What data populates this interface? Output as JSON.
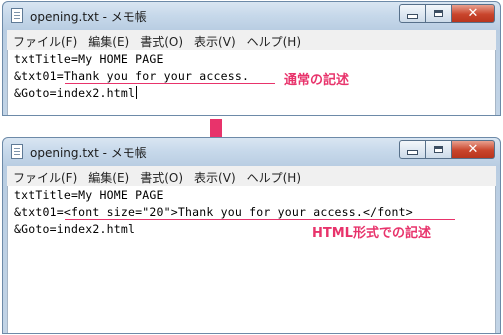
{
  "window_top": {
    "title": "opening.txt - メモ帳",
    "menu": [
      "ファイル(F)",
      "編集(E)",
      "書式(O)",
      "表示(V)",
      "ヘルプ(H)"
    ],
    "lines": [
      "txtTitle=My HOME PAGE",
      "&txt01=Thank you for your access.",
      "&Goto=index2.html"
    ],
    "annotation": "通常の記述"
  },
  "window_bottom": {
    "title": "opening.txt - メモ帳",
    "menu": [
      "ファイル(F)",
      "編集(E)",
      "書式(O)",
      "表示(V)",
      "ヘルプ(H)"
    ],
    "lines": [
      "txtTitle=My HOME PAGE",
      "&txt01=<font size=\"20\">Thank you for your access.</font>",
      "&Goto=index2.html"
    ],
    "annotation": "HTML形式での記述"
  },
  "colors": {
    "annotation": "#e8336b",
    "arrow": "#e8336b"
  },
  "icons": {
    "document": "notepad-document-icon",
    "minimize": "minimize-icon",
    "maximize": "maximize-icon",
    "close": "close-icon",
    "arrow": "down-arrow-icon"
  }
}
